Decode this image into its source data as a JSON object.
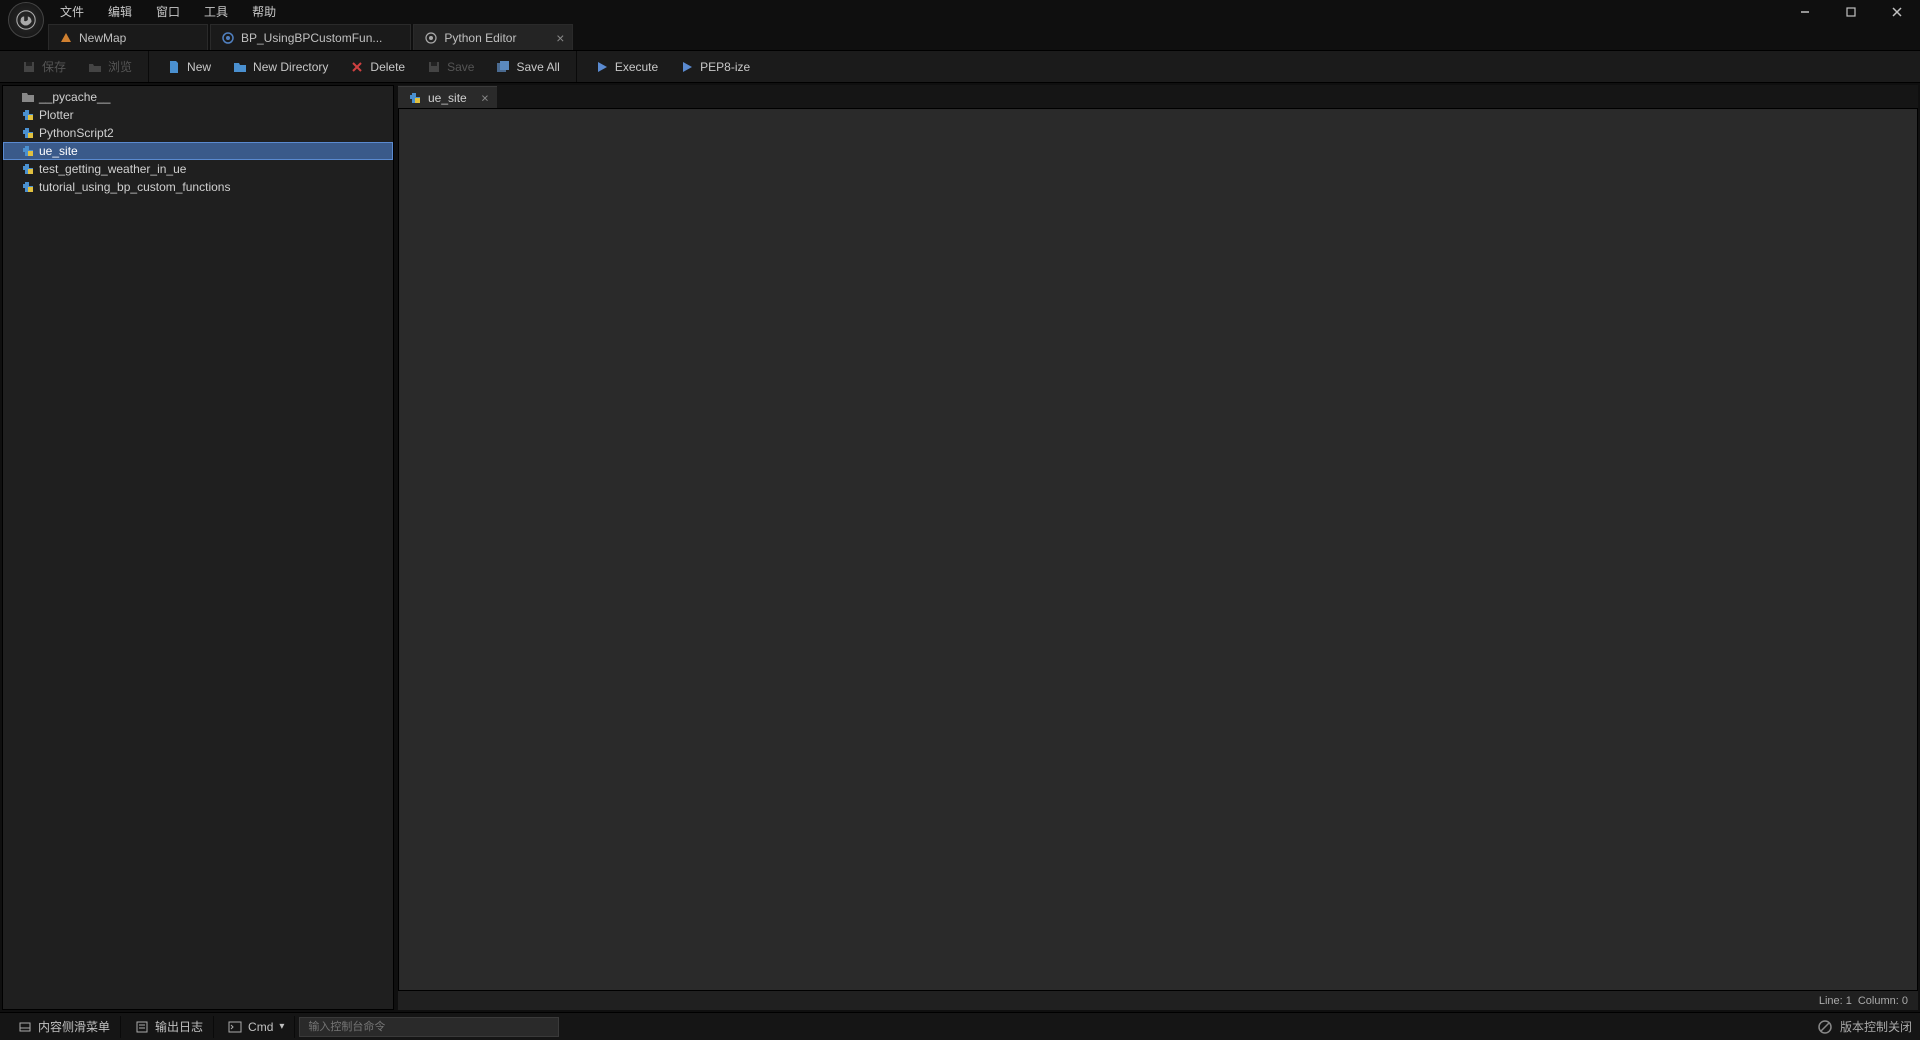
{
  "menu": {
    "items": [
      "文件",
      "编辑",
      "窗口",
      "工具",
      "帮助"
    ]
  },
  "topTabs": [
    {
      "label": "NewMap",
      "iconColor": "#d08030",
      "closable": false
    },
    {
      "label": "BP_UsingBPCustomFun...",
      "iconColor": "#5080c0",
      "closable": false
    },
    {
      "label": "Python Editor",
      "iconColor": "#888",
      "closable": true,
      "active": true
    }
  ],
  "toolbar": {
    "save": "保存",
    "browse": "浏览",
    "new": "New",
    "newDirectory": "New Directory",
    "delete": "Delete",
    "saveEn": "Save",
    "saveAll": "Save All",
    "execute": "Execute",
    "pep8": "PEP8-ize"
  },
  "files": [
    {
      "name": "__pycache__",
      "type": "folder"
    },
    {
      "name": "Plotter",
      "type": "py"
    },
    {
      "name": "PythonScript2",
      "type": "py"
    },
    {
      "name": "ue_site",
      "type": "py",
      "selected": true
    },
    {
      "name": "test_getting_weather_in_ue",
      "type": "py"
    },
    {
      "name": "tutorial_using_bp_custom_functions",
      "type": "py"
    }
  ],
  "editorTabs": [
    {
      "label": "ue_site",
      "closable": true
    }
  ],
  "status": {
    "line": "Line: 1",
    "column": "Column: 0"
  },
  "bottom": {
    "contentDrawer": "内容侧滑菜单",
    "outputLog": "输出日志",
    "cmd": "Cmd",
    "cmdPlaceholder": "输入控制台命令",
    "sourceControl": "版本控制关闭"
  }
}
